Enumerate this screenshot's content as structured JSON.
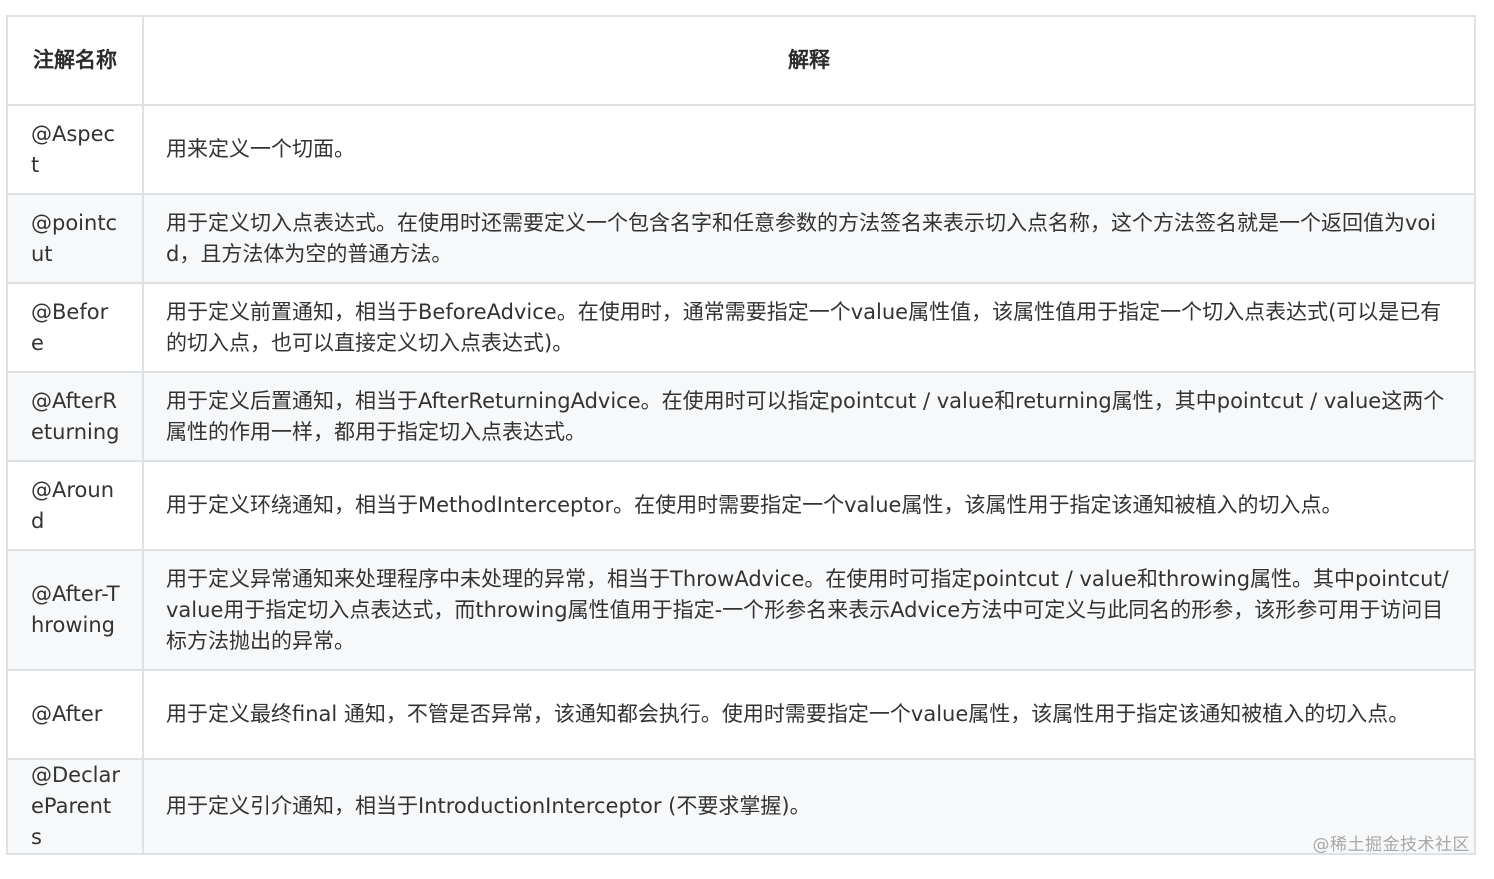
{
  "table": {
    "headers": {
      "name": "注解名称",
      "description": "解释"
    },
    "rows": [
      {
        "name": "@Aspect",
        "description": "用来定义一个切面。"
      },
      {
        "name": "@pointcut",
        "description": "用于定义切入点表达式。在使用时还需要定义一个包含名字和任意参数的方法签名来表示切入点名称，这个方法签名就是一个返回值为void，且方法体为空的普通方法。"
      },
      {
        "name": "@Before",
        "description": "用于定义前置通知，相当于BeforeAdvice。在使用时，通常需要指定一个value属性值，该属性值用于指定一个切入点表达式(可以是已有的切入点，也可以直接定义切入点表达式)。"
      },
      {
        "name": "@AfterReturning",
        "description": "用于定义后置通知，相当于AfterReturningAdvice。在使用时可以指定pointcut / value和returning属性，其中pointcut / value这两个属性的作用一样，都用于指定切入点表达式。"
      },
      {
        "name": "@Around",
        "description": "用于定义环绕通知，相当于MethodInterceptor。在使用时需要指定一个value属性，该属性用于指定该通知被植入的切入点。"
      },
      {
        "name": "@After-Throwing",
        "description": "用于定义异常通知来处理程序中未处理的异常，相当于ThrowAdvice。在使用时可指定pointcut / value和throwing属性。其中pointcut/value用于指定切入点表达式，而throwing属性值用于指定-一个形参名来表示Advice方法中可定义与此同名的形参，该形参可用于访问目标方法抛出的异常。"
      },
      {
        "name": "@After",
        "description": "用于定义最终final 通知，不管是否异常，该通知都会执行。使用时需要指定一个value属性，该属性用于指定该通知被植入的切入点。"
      },
      {
        "name": "@DeclareParents",
        "description": "用于定义引介通知，相当于IntroductionInterceptor (不要求掌握)。"
      }
    ]
  },
  "watermark": "@稀土掘金技术社区"
}
